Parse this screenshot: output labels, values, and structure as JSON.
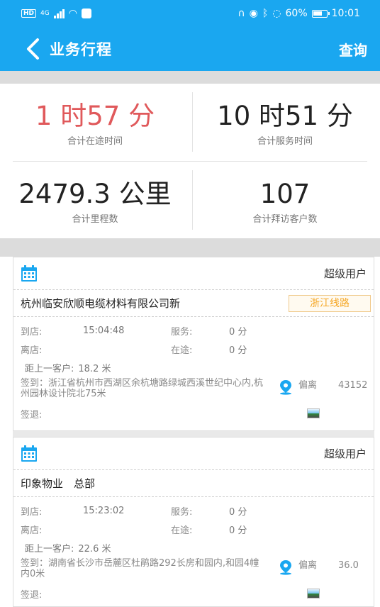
{
  "status_bar": {
    "left_badge": "HD",
    "network": "4G",
    "battery": "60%",
    "time": "10:01"
  },
  "app_bar": {
    "title": "业务行程",
    "action": "查询"
  },
  "stats": [
    {
      "value": "1 时57 分",
      "label": "合计在途时间"
    },
    {
      "value": "10 时51 分",
      "label": "合计服务时间"
    },
    {
      "value": "2479.3 公里",
      "label": "合计里程数"
    },
    {
      "value": "107",
      "label": "合计拜访客户数"
    }
  ],
  "colors": {
    "primary": "#1aa7f0",
    "accent_red": "#e0595b",
    "tag_orange": "#f5a623"
  },
  "cards": [
    {
      "user": "超级用户",
      "company": "杭州临安欣顺电缆材料有限公司新",
      "tag": "浙江线路",
      "arrive_label": "到店:",
      "arrive": "15:04:48",
      "service_label": "服务:",
      "service": "0 分",
      "leave_label": "离店:",
      "leave": "",
      "transit_label": "在途:",
      "transit": "0 分",
      "distance_label": "距上一客户:",
      "distance": "18.2 米",
      "signin": "签到：浙江省杭州市西湖区余杭塘路绿城西溪世纪中心内,杭州园林设计院北75米",
      "deviation_label": "偏离",
      "deviation": "43152",
      "signout": "签退:"
    },
    {
      "user": "超级用户",
      "company": "印象物业　总部",
      "tag": "",
      "arrive_label": "到店:",
      "arrive": "15:23:02",
      "service_label": "服务:",
      "service": "0 分",
      "leave_label": "离店:",
      "leave": "",
      "transit_label": "在途:",
      "transit": "0 分",
      "distance_label": "距上一客户:",
      "distance": "22.6 米",
      "signin": "签到：湖南省长沙市岳麓区杜鹃路292长房和园内,和园4幢内0米",
      "deviation_label": "偏离",
      "deviation": "36.0",
      "signout": "签退:"
    }
  ]
}
